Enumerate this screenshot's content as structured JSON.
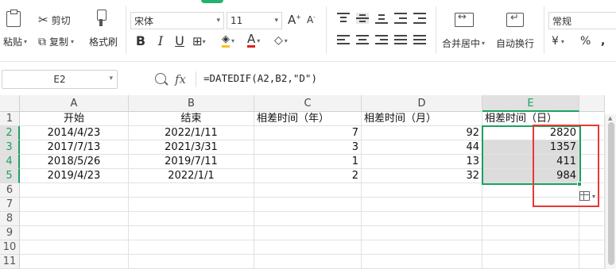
{
  "ribbon": {
    "paste_label": "粘贴",
    "cut_label": "剪切",
    "copy_label": "复制",
    "format_painter_label": "格式刷",
    "font_name": "宋体",
    "font_size": "11",
    "merge_center_label": "合并居中",
    "wrap_text_label": "自动换行",
    "number_format": "常规",
    "currency_symbol": "¥",
    "percent_symbol": "%",
    "accent_color": "#1aa260"
  },
  "formula_bar": {
    "cell_reference": "E2",
    "fx_label": "fx",
    "formula": "=DATEDIF(A2,B2,\"D\")"
  },
  "sheet": {
    "columns": [
      "A",
      "B",
      "C",
      "D",
      "E"
    ],
    "row_numbers": [
      "1",
      "2",
      "3",
      "4",
      "5",
      "6",
      "7",
      "8",
      "9",
      "10",
      "11"
    ],
    "headers": [
      "开始",
      "结束",
      "相差时间（年）",
      "相差时间（月）",
      "相差时间（日）"
    ],
    "rows": [
      [
        "2014/4/23",
        "2022/1/11",
        "7",
        "92",
        "2820"
      ],
      [
        "2017/7/13",
        "2021/3/31",
        "3",
        "44",
        "1357"
      ],
      [
        "2018/5/26",
        "2019/7/11",
        "1",
        "13",
        "411"
      ],
      [
        "2019/4/23",
        "2022/1/1",
        "2",
        "32",
        "984"
      ]
    ],
    "selected_range": "E2:E5",
    "highlight_color": "#e53935"
  }
}
